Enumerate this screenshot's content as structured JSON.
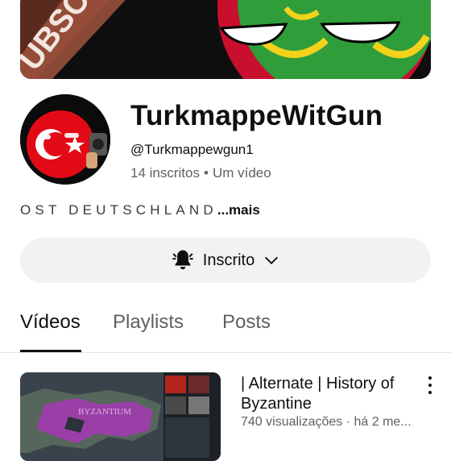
{
  "banner": {
    "overlay_text": "UBSC"
  },
  "channel": {
    "name": "TurkmappeWitGun",
    "handle": "@Turkmappewgun1",
    "subscribers": "14 inscritos",
    "separator": "•",
    "video_count": "Um vídeo",
    "description": "OST DEUTSCHLAND",
    "more_label": "...mais"
  },
  "subscribe": {
    "label": "Inscrito"
  },
  "tabs": [
    {
      "label": "Vídeos",
      "active": true
    },
    {
      "label": "Playlists",
      "active": false
    },
    {
      "label": "Posts",
      "active": false
    }
  ],
  "video": {
    "title": "| Alternate | History of Byzantine",
    "meta": "740 visualizações · há 2 me...",
    "thumb_text": "BYZANTIUM"
  },
  "colors": {
    "accent_red": "#e30a17",
    "banner_green": "#2f9d3a",
    "crescent_yellow": "#f2d21b",
    "tab_active": "#0f0f0f",
    "tab_inactive": "#606060"
  }
}
